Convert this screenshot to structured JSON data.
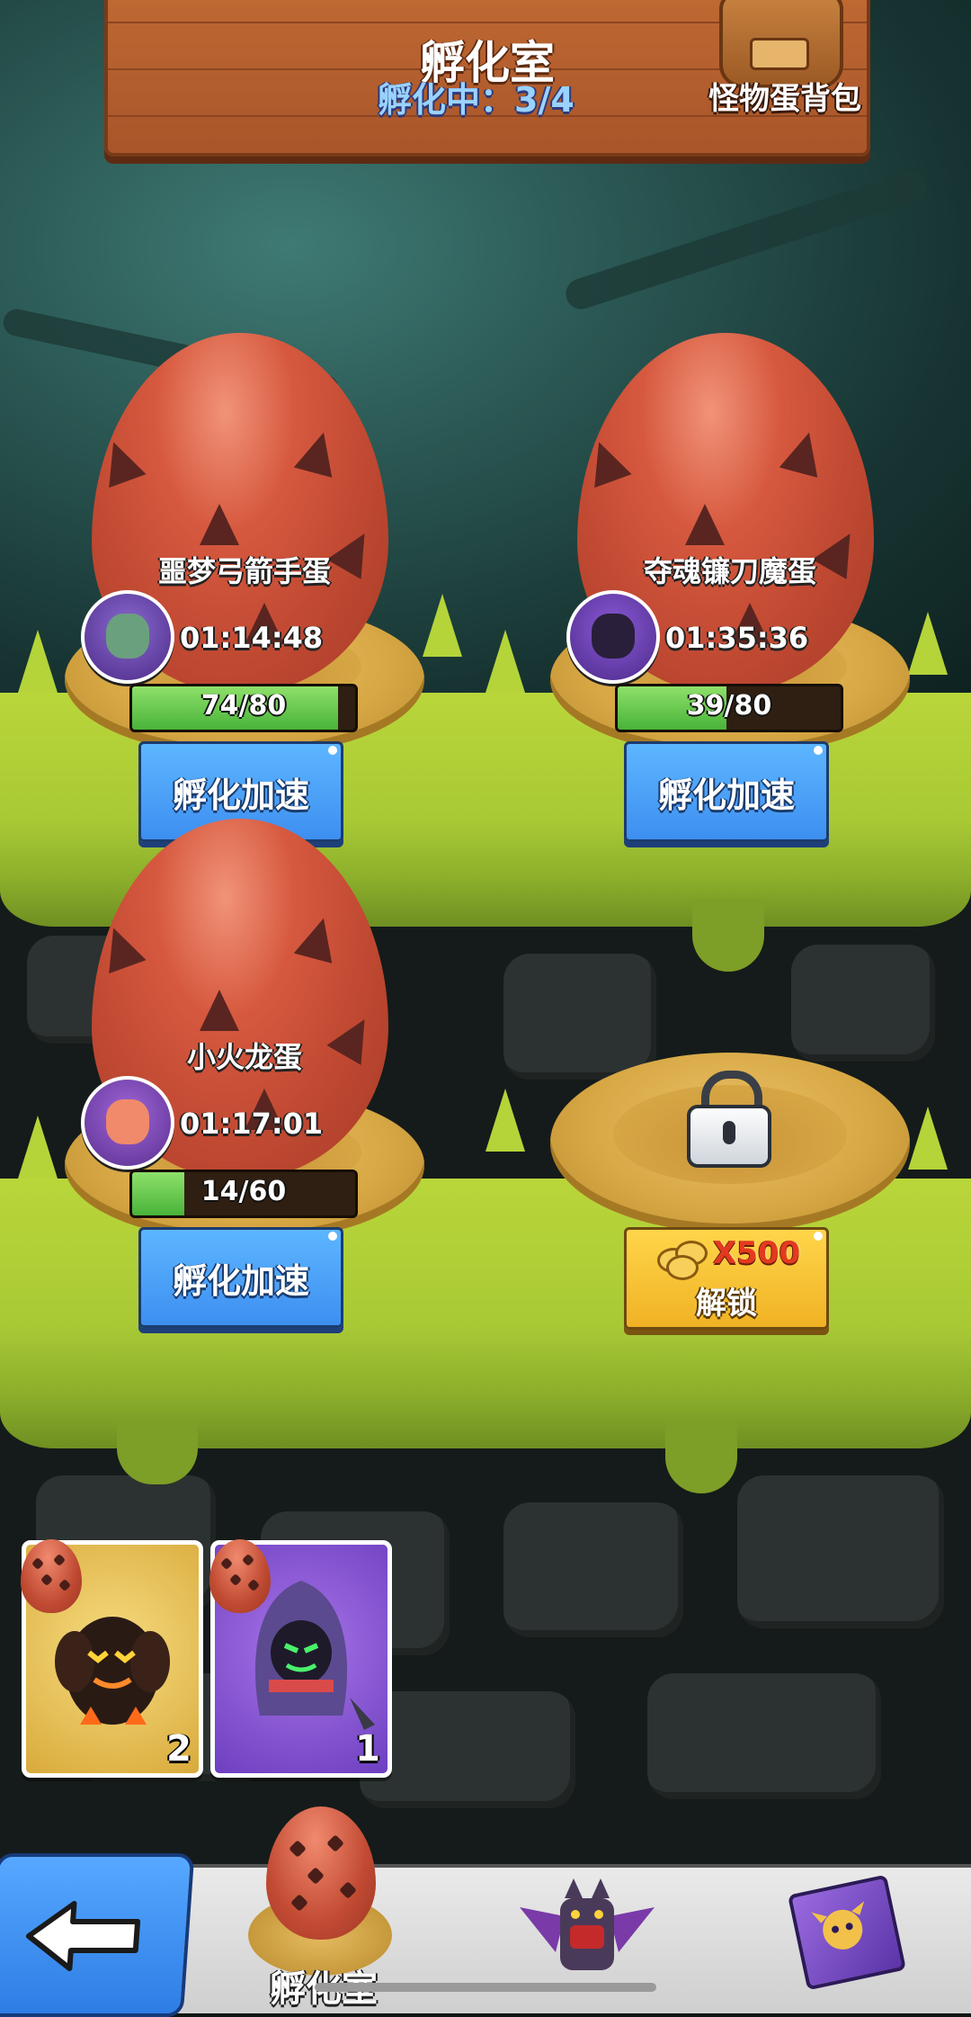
{
  "header": {
    "title": "孵化室",
    "incubating_label": "孵化中：3/4",
    "bag_label": "怪物蛋背包"
  },
  "slots": [
    {
      "egg_name": "噩梦弓箭手蛋",
      "timer": "01:14:48",
      "progress_text": "74/80",
      "progress": 0.925,
      "button": "孵化加速",
      "avatar_icon": "zombie-archer-avatar-icon"
    },
    {
      "egg_name": "夺魂镰刀魔蛋",
      "timer": "01:35:36",
      "progress_text": "39/80",
      "progress": 0.4875,
      "button": "孵化加速",
      "avatar_icon": "reaper-avatar-icon"
    },
    {
      "egg_name": "小火龙蛋",
      "timer": "01:17:01",
      "progress_text": "14/60",
      "progress": 0.233,
      "button": "孵化加速",
      "avatar_icon": "fire-dragon-avatar-icon"
    }
  ],
  "locked_slot": {
    "cost": "X500",
    "button": "解锁",
    "icon": "lock-icon",
    "currency_icon": "coin-icon"
  },
  "inventory": [
    {
      "count": "2",
      "monster": "lava-golem",
      "color": "#e9c255"
    },
    {
      "count": "1",
      "monster": "hooded-reaper",
      "color": "#8e5ad9"
    }
  ],
  "nav": {
    "active_label": "孵化室",
    "back_icon": "back-arrow-icon",
    "items": [
      "incubator-egg-icon",
      "bat-dragon-icon",
      "spellbook-icon"
    ]
  },
  "colors": {
    "speed_button": "#4aa0ff",
    "unlock_button": "#f5c13a",
    "progress_fill": "#5cc243",
    "grass": "#b4d43a"
  }
}
